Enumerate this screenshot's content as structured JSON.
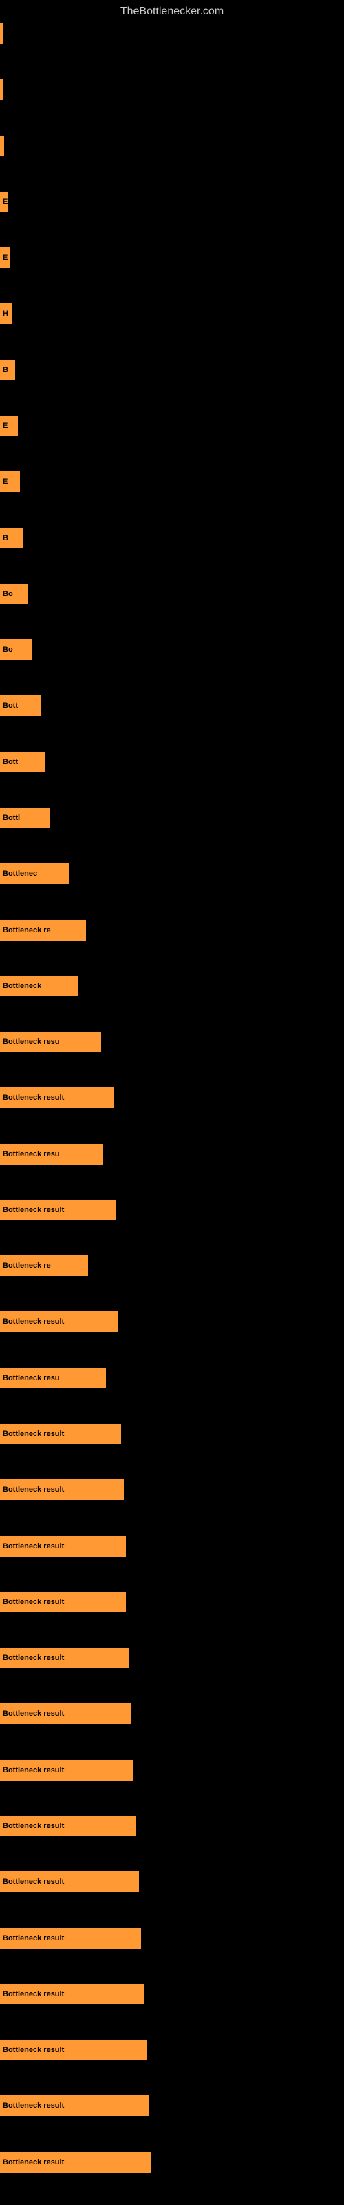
{
  "site": {
    "title": "TheBottlenecker.com"
  },
  "bars": [
    {
      "label": "",
      "width": 2
    },
    {
      "label": "",
      "width": 2
    },
    {
      "label": "",
      "width": 3
    },
    {
      "label": "E",
      "width": 6
    },
    {
      "label": "E",
      "width": 8
    },
    {
      "label": "H",
      "width": 10
    },
    {
      "label": "B",
      "width": 12
    },
    {
      "label": "E",
      "width": 14
    },
    {
      "label": "E",
      "width": 16
    },
    {
      "label": "B",
      "width": 18
    },
    {
      "label": "Bo",
      "width": 22
    },
    {
      "label": "Bo",
      "width": 25
    },
    {
      "label": "Bott",
      "width": 32
    },
    {
      "label": "Bott",
      "width": 36
    },
    {
      "label": "Bottl",
      "width": 40
    },
    {
      "label": "Bottlenec",
      "width": 55
    },
    {
      "label": "Bottleneck re",
      "width": 68
    },
    {
      "label": "Bottleneck",
      "width": 62
    },
    {
      "label": "Bottleneck resu",
      "width": 80
    },
    {
      "label": "Bottleneck result",
      "width": 90
    },
    {
      "label": "Bottleneck resu",
      "width": 82
    },
    {
      "label": "Bottleneck result",
      "width": 92
    },
    {
      "label": "Bottleneck re",
      "width": 70
    },
    {
      "label": "Bottleneck result",
      "width": 94
    },
    {
      "label": "Bottleneck resu",
      "width": 84
    },
    {
      "label": "Bottleneck result",
      "width": 96
    },
    {
      "label": "Bottleneck result",
      "width": 98
    },
    {
      "label": "Bottleneck result",
      "width": 100
    },
    {
      "label": "Bottleneck result",
      "width": 100
    },
    {
      "label": "Bottleneck result",
      "width": 102
    },
    {
      "label": "Bottleneck result",
      "width": 104
    },
    {
      "label": "Bottleneck result",
      "width": 106
    },
    {
      "label": "Bottleneck result",
      "width": 108
    },
    {
      "label": "Bottleneck result",
      "width": 110
    },
    {
      "label": "Bottleneck result",
      "width": 112
    },
    {
      "label": "Bottleneck result",
      "width": 114
    },
    {
      "label": "Bottleneck result",
      "width": 116
    },
    {
      "label": "Bottleneck result",
      "width": 118
    },
    {
      "label": "Bottleneck result",
      "width": 120
    }
  ]
}
